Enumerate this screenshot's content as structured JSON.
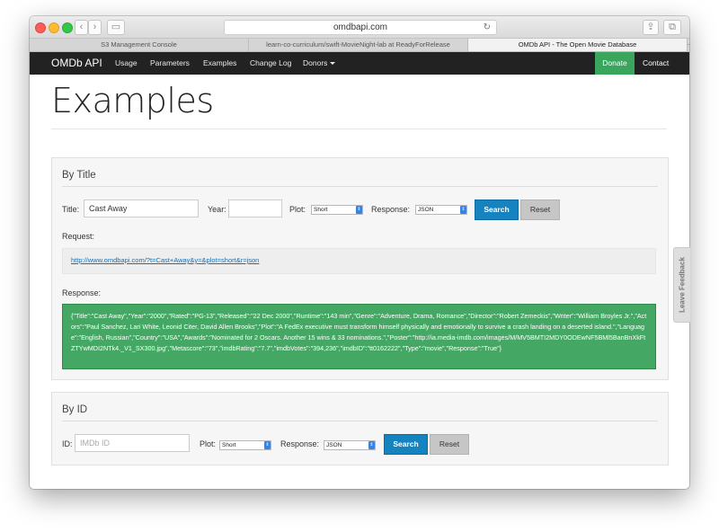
{
  "browser": {
    "url": "omdbapi.com",
    "tabs": [
      {
        "label": "S3 Management Console"
      },
      {
        "label": "learn-co-curriculum/swift-MovieNight-lab at ReadyForRelease"
      },
      {
        "label": "OMDb API - The Open Movie Database"
      }
    ],
    "new_tab": "+"
  },
  "nav": {
    "brand": "OMDb API",
    "items": [
      "Usage",
      "Parameters",
      "Examples",
      "Change Log",
      "Donors"
    ],
    "donate": "Donate",
    "contact": "Contact"
  },
  "page": {
    "title": "Examples"
  },
  "by_title": {
    "heading": "By Title",
    "title_label": "Title:",
    "title_value": "Cast Away",
    "year_label": "Year:",
    "year_value": "",
    "plot_label": "Plot:",
    "plot_value": "Short",
    "response_label": "Response:",
    "response_value": "JSON",
    "search_label": "Search",
    "reset_label": "Reset",
    "request_heading": "Request:",
    "request_url": "http://www.omdbapi.com/?t=Cast+Away&y=&plot=short&r=json",
    "response_heading": "Response:",
    "response_text": "{\"Title\":\"Cast Away\",\"Year\":\"2000\",\"Rated\":\"PG-13\",\"Released\":\"22 Dec 2000\",\"Runtime\":\"143 min\",\"Genre\":\"Adventure, Drama, Romance\",\"Director\":\"Robert Zemeckis\",\"Writer\":\"William Broyles Jr.\",\"Actors\":\"Paul Sanchez, Lari White, Leonid Citer, David Allen Brooks\",\"Plot\":\"A FedEx executive must transform himself physically and emotionally to survive a crash landing on a deserted island.\",\"Language\":\"English, Russian\",\"Country\":\"USA\",\"Awards\":\"Nominated for 2 Oscars. Another 15 wins & 33 nominations.\",\"Poster\":\"http://ia.media-imdb.com/images/M/MV5BMTI2MDY0ODEwNF5BMl5BanBnXkFtZTYwMDI2NTk4._V1_SX300.jpg\",\"Metascore\":\"73\",\"imdbRating\":\"7.7\",\"imdbVotes\":\"394,236\",\"imdbID\":\"tt0162222\",\"Type\":\"movie\",\"Response\":\"True\"}"
  },
  "by_id": {
    "heading": "By ID",
    "id_label": "ID:",
    "id_placeholder": "IMDb ID",
    "plot_label": "Plot:",
    "plot_value": "Short",
    "response_label": "Response:",
    "response_value": "JSON",
    "search_label": "Search",
    "reset_label": "Reset"
  },
  "feedback": {
    "label": "Leave Feedback"
  },
  "colors": {
    "navbar": "#222222",
    "donate": "#3aa55d",
    "search_button": "#1683c1",
    "response_box": "#45a764"
  }
}
